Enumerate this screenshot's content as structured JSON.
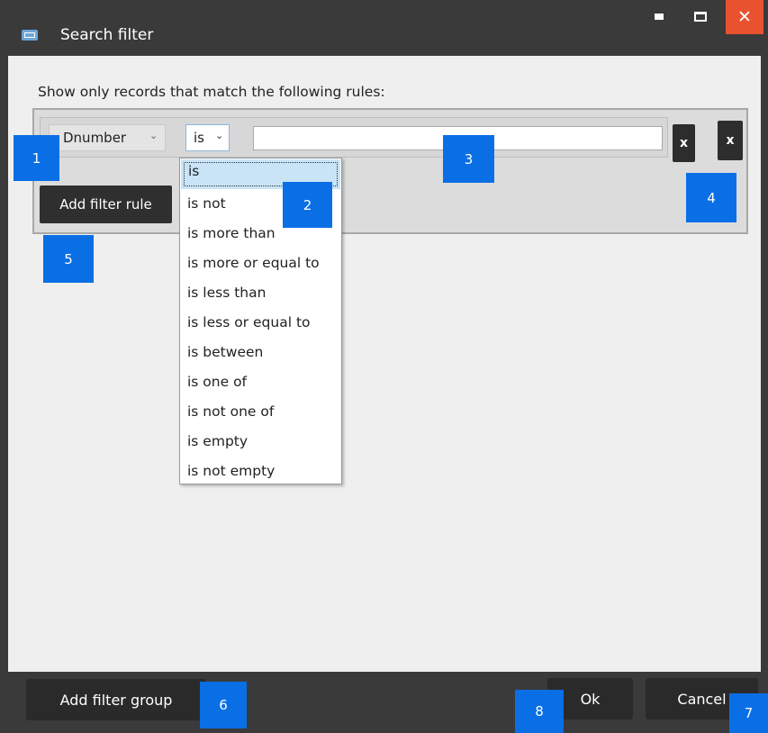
{
  "window": {
    "title": "Search filter",
    "close_glyph": "✕",
    "icons": [
      "window-app-icon",
      "minimize-icon",
      "maximize-icon",
      "close-icon"
    ]
  },
  "intro_text": "Show only records that match the following rules:",
  "rule": {
    "field_value": "Dnumber",
    "operator_value": "is",
    "value_input": "",
    "remove_label": "x"
  },
  "group": {
    "remove_label": "x",
    "add_rule_label": "Add filter rule"
  },
  "operator_options": [
    "is",
    "is not",
    "is more than",
    "is more or equal to",
    "is less than",
    "is less or equal to",
    "is between",
    "is one of",
    "is not one of",
    "is empty",
    "is not empty"
  ],
  "footer": {
    "add_group_label": "Add filter group",
    "ok_label": "Ok",
    "cancel_label": "Cancel"
  },
  "badges": [
    "1",
    "2",
    "3",
    "4",
    "5",
    "6",
    "7",
    "8"
  ],
  "colors": {
    "badge": "#0a6fe5",
    "close": "#e8522f",
    "titlebar": "#3a3a3a",
    "selected_option": "#c9e4f7"
  }
}
